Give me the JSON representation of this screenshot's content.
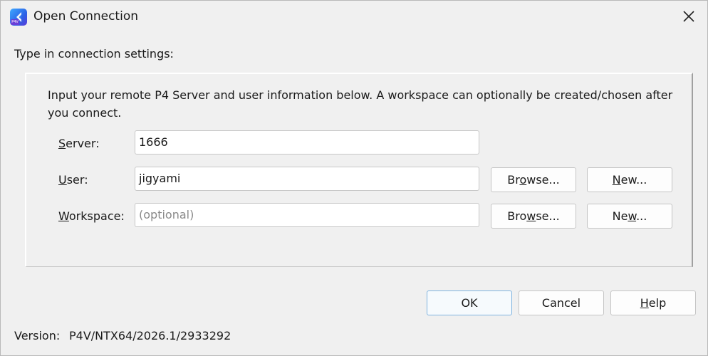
{
  "window": {
    "title": "Open Connection"
  },
  "prompt": "Type in connection settings:",
  "info_text": "Input your remote P4 Server and user information below. A workspace can optionally be created/chosen after you connect.",
  "server": {
    "label_key": "S",
    "label_rest": "erver:",
    "value": "1666"
  },
  "user": {
    "label_key": "U",
    "label_rest": "ser:",
    "value": "jigyami",
    "browse_pre": "Br",
    "browse_key": "o",
    "browse_post": "wse...",
    "new_key": "N",
    "new_post": "ew..."
  },
  "workspace": {
    "label_key": "W",
    "label_rest": "orkspace:",
    "placeholder": "(optional)",
    "browse_pre": "Bro",
    "browse_key": "w",
    "browse_post": "se...",
    "new_pre": "Ne",
    "new_key": "w",
    "new_post": "..."
  },
  "buttons": {
    "ok": "OK",
    "cancel": "Cancel",
    "help_key": "H",
    "help_rest": "elp"
  },
  "version": {
    "label": "Version:",
    "value": "P4V/NTX64/2026.1/2933292"
  },
  "icon_badge": "P4V",
  "colors": {
    "accent_border": "#7fb3df",
    "background": "#f0f0f0"
  }
}
